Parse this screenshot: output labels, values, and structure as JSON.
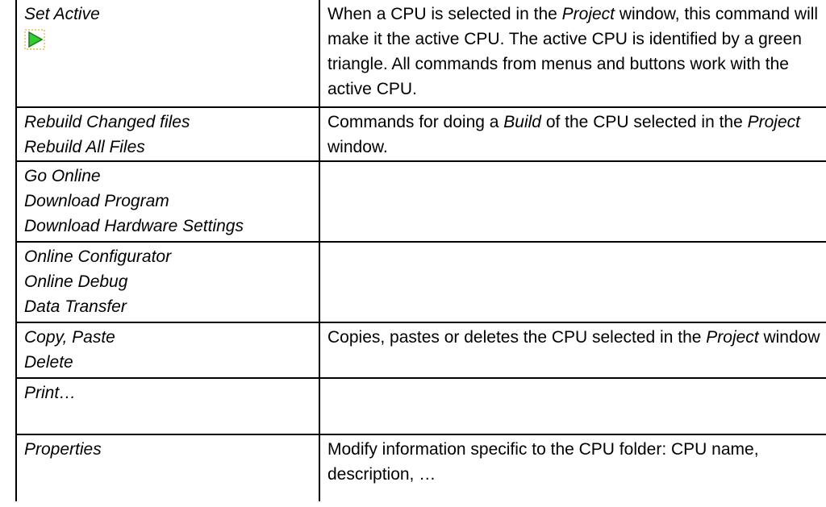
{
  "rows": [
    {
      "commands": [
        "Set Active"
      ],
      "icon": "green-play-triangle-icon",
      "description_parts": [
        {
          "text": "When a CPU is selected in the ",
          "italic": false
        },
        {
          "text": "Project",
          "italic": true
        },
        {
          "text": " window, this command will make it the active CPU. The active CPU is identified by a green triangle. All commands from menus and buttons work with the active CPU.",
          "italic": false
        }
      ]
    },
    {
      "commands": [
        "Rebuild Changed files",
        "Rebuild All Files"
      ],
      "description_parts": [
        {
          "text": "Commands for doing a ",
          "italic": false
        },
        {
          "text": "Build",
          "italic": true
        },
        {
          "text": " of the CPU selected in the ",
          "italic": false
        },
        {
          "text": "Project",
          "italic": true
        },
        {
          "text": " window.",
          "italic": false
        }
      ]
    },
    {
      "commands": [
        "Go Online",
        "Download Program",
        "Download Hardware Settings"
      ],
      "description_parts": []
    },
    {
      "commands": [
        "Online Configurator",
        "Online Debug",
        "Data Transfer"
      ],
      "description_parts": []
    },
    {
      "commands": [
        "Copy, Paste",
        "Delete"
      ],
      "description_parts": [
        {
          "text": "Copies, pastes or deletes the CPU selected in the ",
          "italic": false
        },
        {
          "text": "Project",
          "italic": true
        },
        {
          "text": " window",
          "italic": false
        }
      ]
    },
    {
      "commands": [
        "Print…"
      ],
      "description_parts": []
    },
    {
      "commands": [
        "Properties"
      ],
      "description_parts": [
        {
          "text": "Modify information specific to the CPU folder: CPU name, description, …",
          "italic": false
        }
      ]
    }
  ],
  "colors": {
    "icon_fill": "#33cc33",
    "icon_outline": "#1a7a1a",
    "icon_frame": "#d0a000",
    "border": "#000000"
  }
}
